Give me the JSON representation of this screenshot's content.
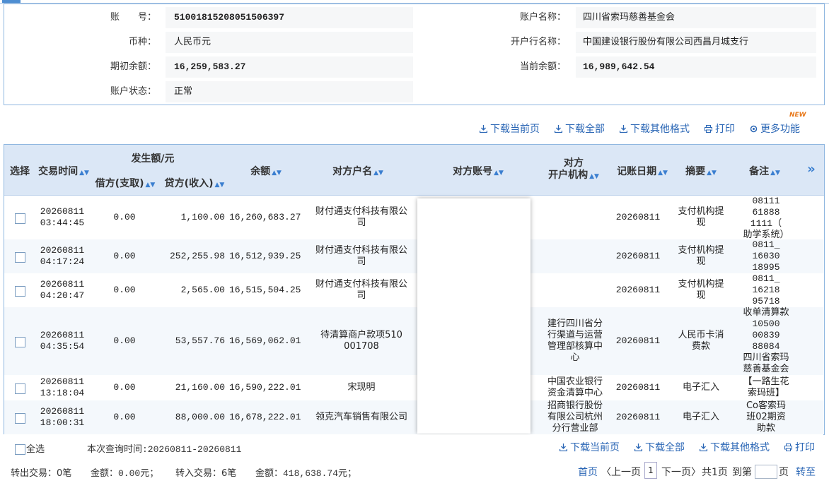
{
  "account": {
    "number_label": "账　　号：",
    "number": "5100181520805150639​7",
    "name_label": "账户名称：",
    "name": "四川省索玛慈善基金会",
    "currency_label": "币种：",
    "currency": "人民币元",
    "bank_label": "开户行名称：",
    "bank": "中国建设银行股份有限公司西昌月城支行",
    "opening_label": "期初余额：",
    "opening": "16,259,583.27",
    "current_label": "当前余额：",
    "current": "16,989,642.54",
    "status_label": "账户状态：",
    "status": "正常"
  },
  "toolbar": {
    "download_page": "下载当前页",
    "download_all": "下载全部",
    "download_other": "下载其他格式",
    "print": "打印",
    "more": "更多功能",
    "new_badge": "NEW"
  },
  "table": {
    "headers": {
      "select": "选择",
      "time": "交易时间",
      "amount_group": "发生额/元",
      "debit": "借方(支取)",
      "credit": "贷方(收入)",
      "balance": "余额",
      "counterparty_name": "对方户名",
      "counterparty_account": "对方账号",
      "counterparty_bank_1": "对方",
      "counterparty_bank_2": "开户机构",
      "post_date": "记账日期",
      "summary": "摘要",
      "remark": "备注",
      "more": "»"
    },
    "rows": [
      {
        "date": "20260811",
        "time": "03:44:45",
        "debit": "0.00",
        "credit": "1,100.00",
        "balance": "16,260,683.27",
        "cp_name_1": "财付通支付科技有限公",
        "cp_name_2": "司",
        "cp_bank": [
          "",
          "",
          ""
        ],
        "post": "20260811",
        "summary_1": "支付机构提",
        "summary_2": "现",
        "remark": [
          "08111",
          "61888",
          "1111（",
          "助学系统）"
        ]
      },
      {
        "date": "20260811",
        "time": "04:17:24",
        "debit": "0.00",
        "credit": "252,255.98",
        "balance": "16,512,939.25",
        "cp_name_1": "财付通支付科技有限公",
        "cp_name_2": "司",
        "cp_bank": [
          "",
          "",
          ""
        ],
        "post": "20260811",
        "summary_1": "支付机构提",
        "summary_2": "现",
        "remark": [
          "0811_",
          "16030",
          "18995",
          ""
        ]
      },
      {
        "date": "20260811",
        "time": "04:20:47",
        "debit": "0.00",
        "credit": "2,565.00",
        "balance": "16,515,504.25",
        "cp_name_1": "财付通支付科技有限公",
        "cp_name_2": "司",
        "cp_bank": [
          "",
          "",
          ""
        ],
        "post": "20260811",
        "summary_1": "支付机构提",
        "summary_2": "现",
        "remark": [
          "0811_",
          "16218",
          "95718",
          ""
        ]
      },
      {
        "date": "20260811",
        "time": "04:35:54",
        "debit": "0.00",
        "credit": "53,557.76",
        "balance": "16,569,062.01",
        "cp_name_1": "待清算商户款项510",
        "cp_name_2": "001708",
        "cp_bank": [
          "建行四川省分",
          "行渠道与运营",
          "管理部核算中",
          "心"
        ],
        "post": "20260811",
        "summary_1": "人民币卡消",
        "summary_2": "费款",
        "remark": [
          "收单清算款",
          "10500",
          "00839",
          "88084",
          "四川省索玛",
          "慈善基金会"
        ]
      },
      {
        "date": "20260811",
        "time": "13:18:04",
        "debit": "0.00",
        "credit": "21,160.00",
        "balance": "16,590,222.01",
        "cp_name_1": "宋现明",
        "cp_name_2": "",
        "cp_bank": [
          "中国农业银行",
          "资金清算中心"
        ],
        "post": "20260811",
        "summary_1": "电子汇入",
        "summary_2": "",
        "remark": [
          "【一路生花",
          "索玛班】"
        ]
      },
      {
        "date": "20260811",
        "time": "18:00:31",
        "debit": "0.00",
        "credit": "88,000.00",
        "balance": "16,678,222.01",
        "cp_name_1": "领克汽车销售有限公司",
        "cp_name_2": "",
        "cp_bank": [
          "招商银行股份",
          "有限公司杭州",
          "分行营业部"
        ],
        "post": "20260811",
        "summary_1": "电子汇入",
        "summary_2": "",
        "remark": [
          "Co客索玛",
          "班02期资",
          "助款"
        ]
      }
    ]
  },
  "footer": {
    "select_all": "全选",
    "query_time": "本次查询时间:20260811-20260811",
    "download_page": "下载当前页",
    "download_all": "下载全部",
    "download_other": "下载其他格式",
    "print": "打印",
    "out_count": "转出交易：0笔",
    "out_amount": "金额：0.00元；",
    "in_count": "转入交易：6笔",
    "in_amount": "金额：418,638.74元；",
    "first": "首页",
    "prev": "〈上一页",
    "page": "1",
    "next": "下一页〉",
    "total": "共1页",
    "goto": "到第",
    "page_unit": "页",
    "jump": "转至"
  }
}
